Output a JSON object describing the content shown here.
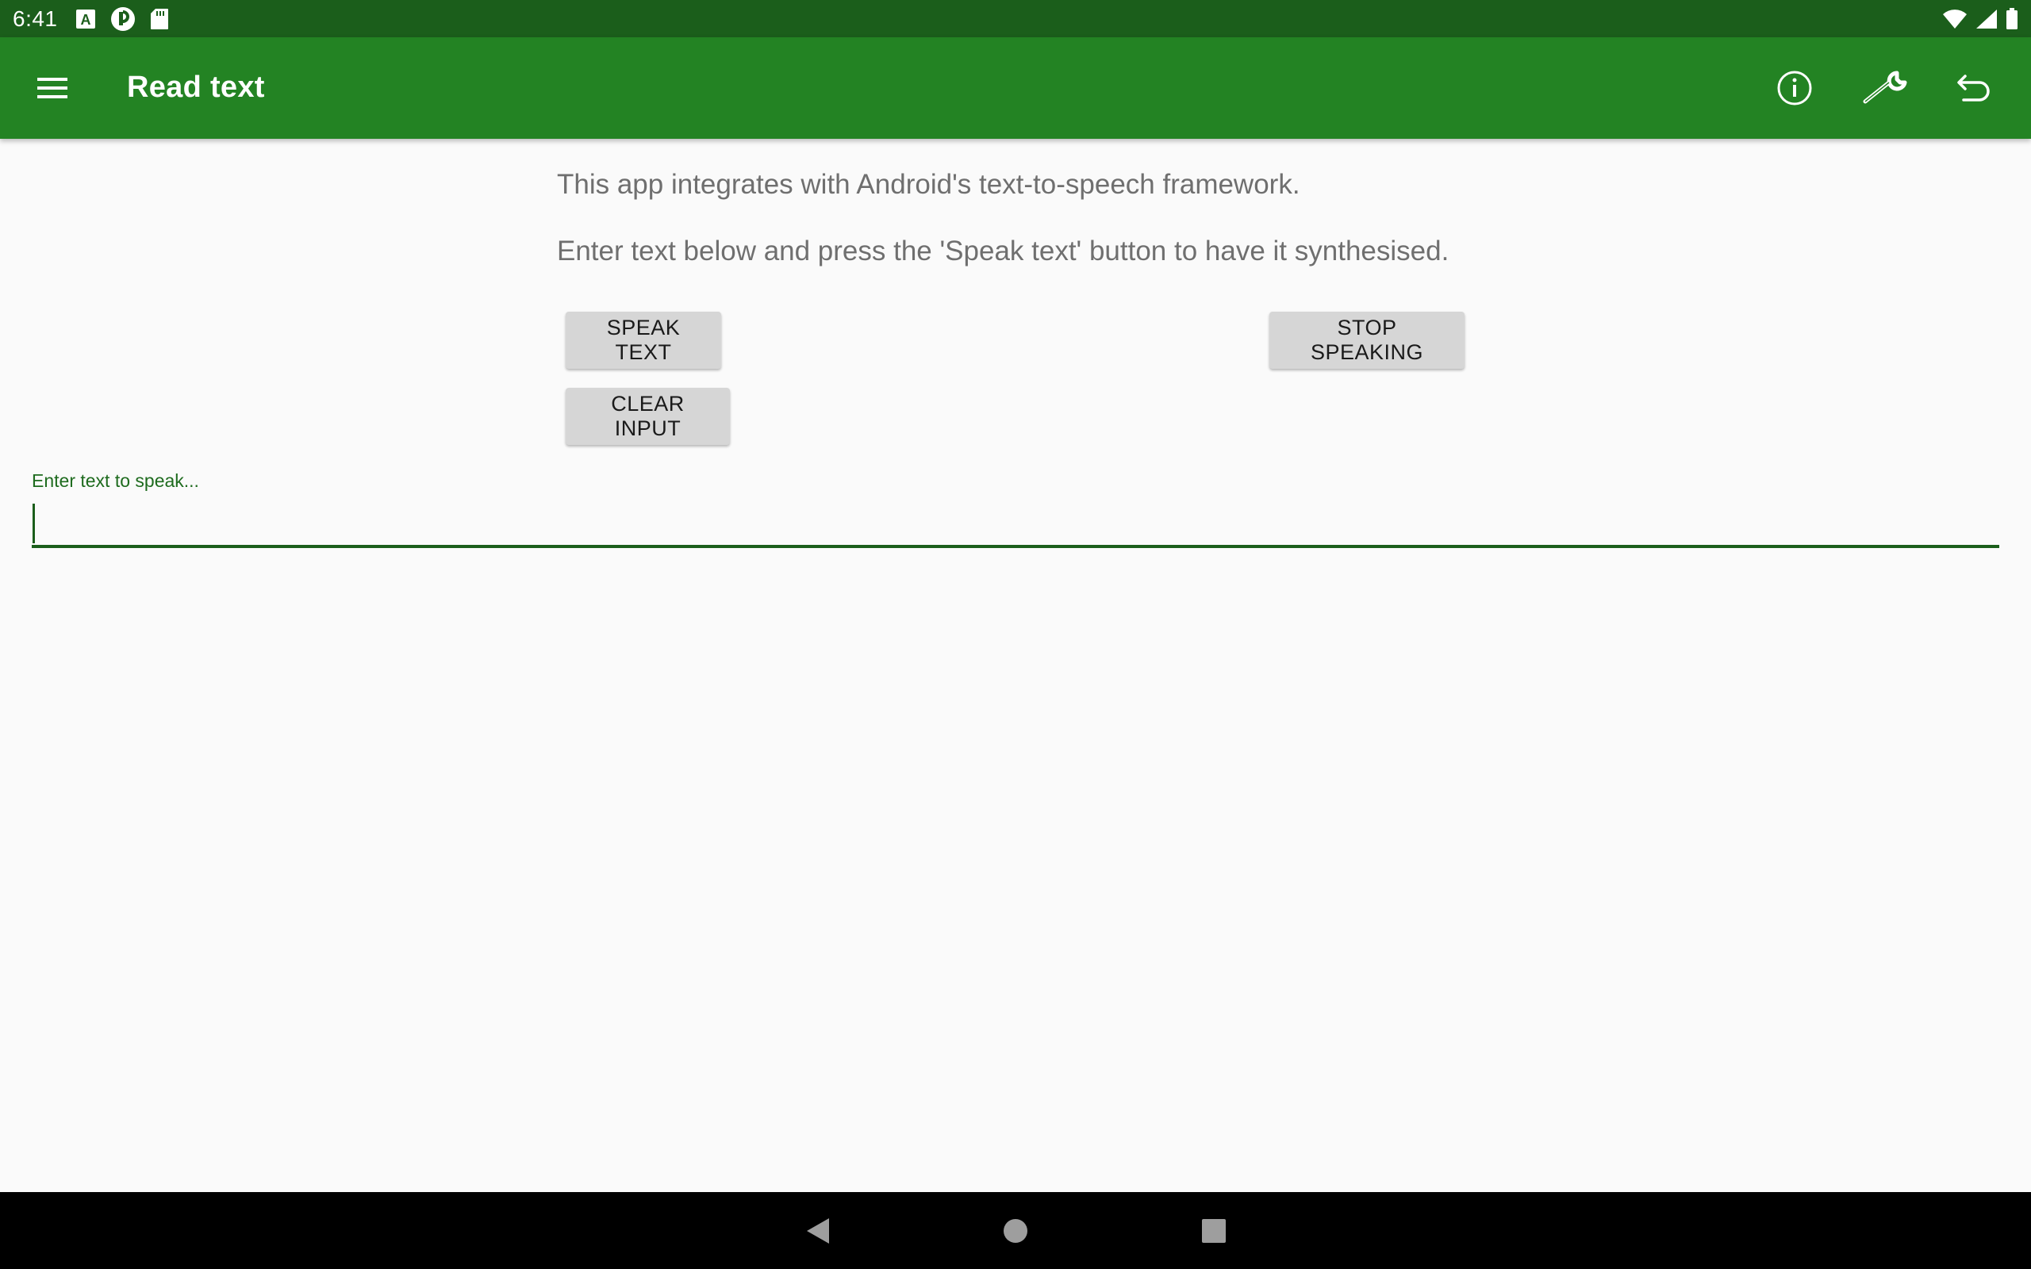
{
  "status_bar": {
    "time": "6:41",
    "left_icons": [
      "font-icon",
      "podcast-icon",
      "sd-card-icon"
    ],
    "right_icons": [
      "wifi-icon",
      "signal-icon",
      "battery-icon"
    ]
  },
  "app_bar": {
    "title": "Read text",
    "actions": [
      "info-icon",
      "wrench-icon",
      "undo-icon"
    ],
    "color": "#238323"
  },
  "main": {
    "description_1": "This app integrates with Android's text-to-speech framework.",
    "description_2": "Enter text below and press the 'Speak text' button to have it synthesised.",
    "speak_button": "SPEAK TEXT",
    "stop_button": "STOP SPEAKING",
    "clear_button": "CLEAR INPUT",
    "input_label": "Enter text to speak...",
    "input_value": ""
  },
  "nav_bar": {
    "buttons": [
      "back-icon",
      "home-icon",
      "recents-icon"
    ]
  }
}
